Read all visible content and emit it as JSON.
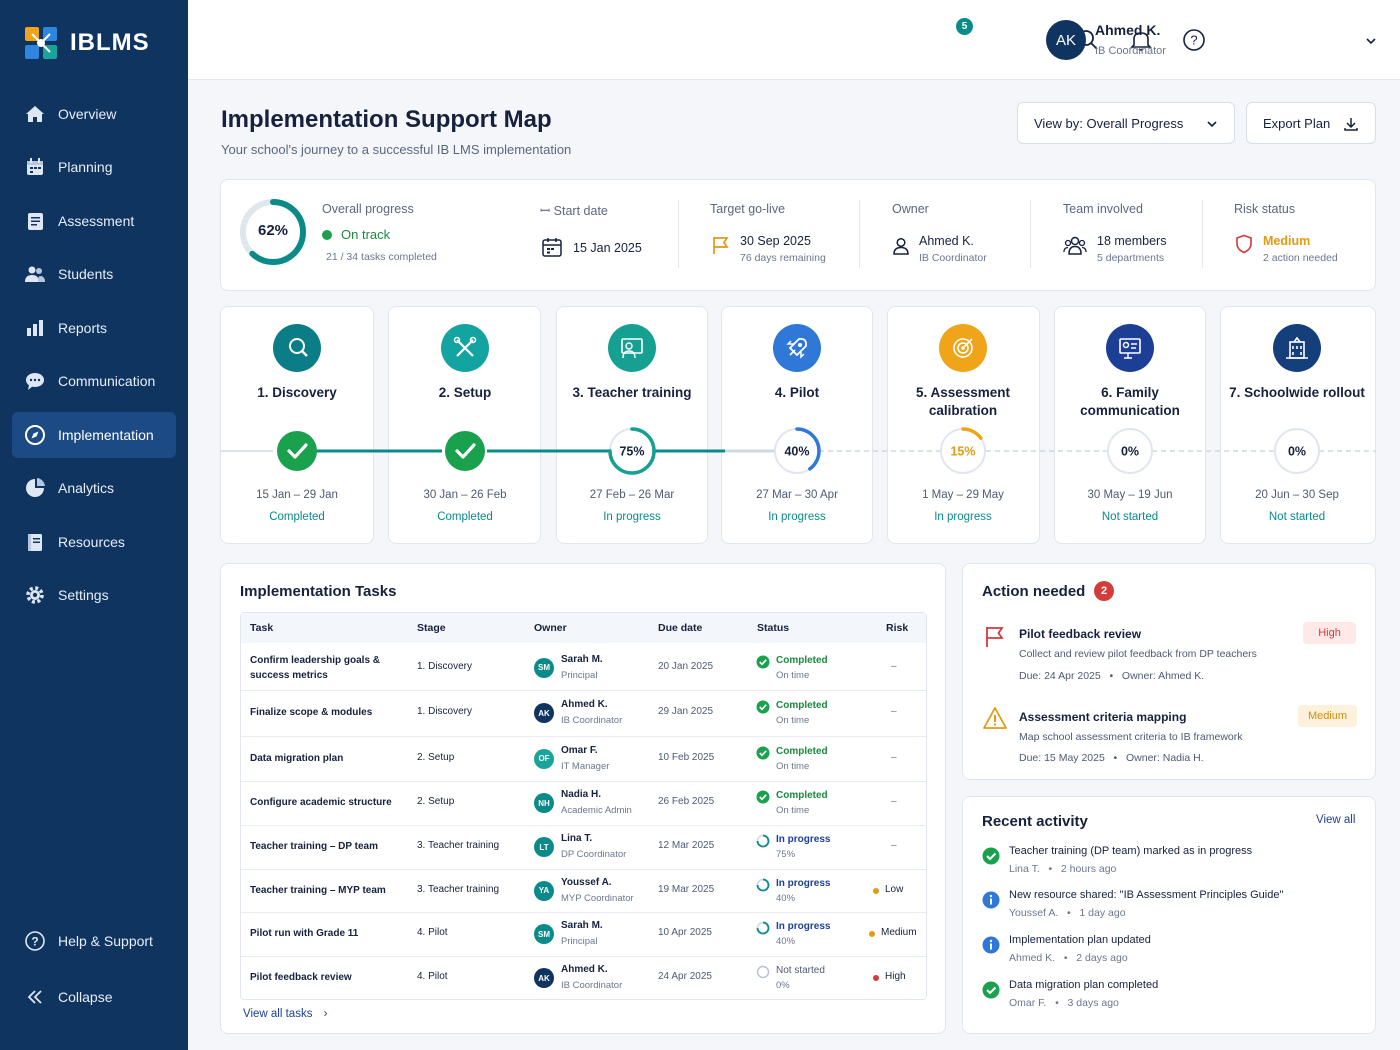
{
  "app": {
    "name": "IBLMS"
  },
  "sidebar": {
    "items": [
      {
        "label": "Overview",
        "icon": "home-icon"
      },
      {
        "label": "Planning",
        "icon": "calendar-icon"
      },
      {
        "label": "Assessment",
        "icon": "clipboard-icon"
      },
      {
        "label": "Students",
        "icon": "users-icon"
      },
      {
        "label": "Reports",
        "icon": "bar-chart-icon"
      },
      {
        "label": "Communication",
        "icon": "chat-icon"
      },
      {
        "label": "Implementation",
        "icon": "compass-icon",
        "active": true
      },
      {
        "label": "Analytics",
        "icon": "pie-chart-icon"
      },
      {
        "label": "Resources",
        "icon": "book-icon"
      },
      {
        "label": "Settings",
        "icon": "gear-icon"
      }
    ],
    "help_label": "Help & Support",
    "collapse_label": "Collapse"
  },
  "header": {
    "notifications_count": "5",
    "user": {
      "initials": "AK",
      "name": "Ahmed K.",
      "role": "IB Coordinator"
    }
  },
  "page": {
    "title": "Implementation Support Map",
    "subtitle": "Your school's journey to a successful IB LMS implementation",
    "view_by_label": "View by: Overall Progress",
    "export_label": "Export Plan"
  },
  "summary": {
    "progress_percent": "62%",
    "progress_value": 0.62,
    "progress_label": "Overall progress",
    "status": "On track",
    "tasks_completed": "21 / 34 tasks completed",
    "start_label": "Start date",
    "start_date": "15 Jan 2025",
    "golive_label": "Target go-live",
    "golive_date": "30 Sep 2025",
    "golive_remaining": "76 days remaining",
    "owner_label": "Owner",
    "owner_name": "Ahmed K.",
    "owner_role": "IB Coordinator",
    "team_label": "Team involved",
    "team_members": "18 members",
    "team_departments": "5 departments",
    "risk_label": "Risk status",
    "risk_level": "Medium",
    "risk_action": "2 action needed"
  },
  "stages": [
    {
      "title": "1. Discovery",
      "progress": "",
      "value": 1.0,
      "dates": "15 Jan – 29 Jan",
      "status": "Completed",
      "color": "#0b7d86",
      "icon": "search-icon"
    },
    {
      "title": "2. Setup",
      "progress": "",
      "value": 1.0,
      "dates": "30 Jan – 26 Feb",
      "status": "Completed",
      "color": "#13a3a0",
      "icon": "tools-icon"
    },
    {
      "title": "3. Teacher training",
      "progress": "75%",
      "value": 0.75,
      "dates": "27 Feb – 26 Mar",
      "status": "In progress",
      "color": "#15a091",
      "icon": "teacher-icon"
    },
    {
      "title": "4. Pilot",
      "progress": "40%",
      "value": 0.4,
      "dates": "27 Mar – 30 Apr",
      "status": "In progress",
      "color": "#2f78d8",
      "icon": "rocket-icon"
    },
    {
      "title": "5. Assessment calibration",
      "progress": "15%",
      "value": 0.15,
      "dates": "1 May – 29 May",
      "status": "In progress",
      "color": "#efa419",
      "icon": "target-icon"
    },
    {
      "title": "6. Family communication",
      "progress": "0%",
      "value": 0,
      "dates": "30 May – 19 Jun",
      "status": "Not started",
      "color": "#1c3f95",
      "icon": "presentation-icon"
    },
    {
      "title": "7. Schoolwide rollout",
      "progress": "0%",
      "value": 0,
      "dates": "20 Jun – 30 Sep",
      "status": "Not started",
      "color": "#143f7a",
      "icon": "building-icon"
    }
  ],
  "tasks": {
    "title": "Implementation Tasks",
    "columns": [
      "Task",
      "Stage",
      "Owner",
      "Due date",
      "Status",
      "Risk"
    ],
    "rows": [
      {
        "task": "Confirm leadership goals & success metrics",
        "stage": "1. Discovery",
        "initials": "SM",
        "owner": "Sarah M.",
        "role": "Principal",
        "due": "20 Jan 2025",
        "status": "Completed",
        "status_sub": "On time",
        "risk": "–"
      },
      {
        "task": "Finalize scope & modules",
        "stage": "1. Discovery",
        "initials": "AK",
        "owner": "Ahmed K.",
        "role": "IB Coordinator",
        "due": "29 Jan 2025",
        "status": "Completed",
        "status_sub": "On time",
        "risk": "–"
      },
      {
        "task": "Data migration plan",
        "stage": "2. Setup",
        "initials": "OF",
        "owner": "Omar F.",
        "role": "IT Manager",
        "due": "10 Feb 2025",
        "status": "Completed",
        "status_sub": "On time",
        "risk": "–"
      },
      {
        "task": "Configure academic structure",
        "stage": "2. Setup",
        "initials": "NH",
        "owner": "Nadia H.",
        "role": "Academic Admin",
        "due": "26 Feb 2025",
        "status": "Completed",
        "status_sub": "On time",
        "risk": "–"
      },
      {
        "task": "Teacher training – DP team",
        "stage": "3. Teacher training",
        "initials": "LT",
        "owner": "Lina T.",
        "role": "DP Coordinator",
        "due": "12 Mar 2025",
        "status": "In progress",
        "status_sub": "75%",
        "risk": "–"
      },
      {
        "task": "Teacher training – MYP team",
        "stage": "3. Teacher training",
        "initials": "YA",
        "owner": "Youssef A.",
        "role": "MYP Coordinator",
        "due": "19 Mar 2025",
        "status": "In progress",
        "status_sub": "40%",
        "risk": "Low"
      },
      {
        "task": "Pilot run with Grade 11",
        "stage": "4. Pilot",
        "initials": "SM",
        "owner": "Sarah M.",
        "role": "Principal",
        "due": "10 Apr 2025",
        "status": "In progress",
        "status_sub": "40%",
        "risk": "Medium"
      },
      {
        "task": "Pilot feedback review",
        "stage": "4. Pilot",
        "initials": "AK",
        "owner": "Ahmed K.",
        "role": "IB Coordinator",
        "due": "24 Apr 2025",
        "status": "Not started",
        "status_sub": "0%",
        "risk": "High"
      }
    ],
    "view_all_label": "View all tasks"
  },
  "action_needed": {
    "title": "Action needed",
    "count": "2",
    "items": [
      {
        "title": "Pilot feedback review",
        "desc": "Collect and review pilot feedback from DP teachers",
        "meta": "Due: 24 Apr 2025   •   Owner: Ahmed K.",
        "level": "High"
      },
      {
        "title": "Assessment criteria mapping",
        "desc": "Map school assessment criteria to IB framework",
        "meta": "Due: 15 May 2025   •   Owner: Nadia H.",
        "level": "Medium"
      }
    ]
  },
  "recent_activity": {
    "title": "Recent activity",
    "view_all": "View all",
    "items": [
      {
        "text": "Teacher training (DP team) marked as in progress",
        "meta": "Lina T.   •   2 hours ago",
        "type": "check"
      },
      {
        "text": "New resource shared: \"IB Assessment Principles Guide\"",
        "meta": "Youssef A.   •   1 day ago",
        "type": "info"
      },
      {
        "text": "Implementation plan updated",
        "meta": "Ahmed K.   •   2 days ago",
        "type": "info"
      },
      {
        "text": "Data migration plan completed",
        "meta": "Omar F.   •   3 days ago",
        "type": "check"
      }
    ]
  },
  "colors": {
    "sidebar": "#0f3460",
    "accent": "#0b8a8a",
    "medium": "#e29a12",
    "high": "#d43b3b",
    "info": "#2f78d8"
  }
}
